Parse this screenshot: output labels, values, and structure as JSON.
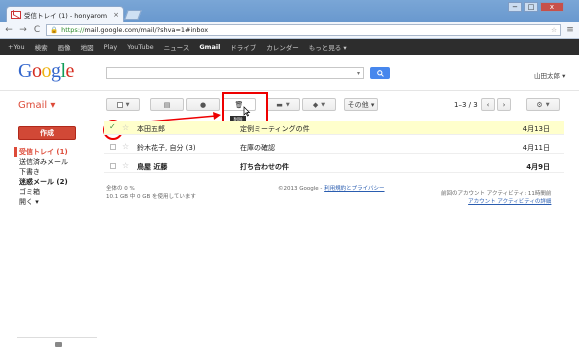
{
  "browser": {
    "tab_title": "受信トレイ (1) - honyarom",
    "tab_close": "×",
    "url_scheme": "https://",
    "url_rest": "mail.google.com/mail/?shva=1#inbox",
    "back_icon": "←",
    "forward_icon": "→",
    "reload_icon": "C",
    "star_icon": "☆",
    "menu_icon": "≡",
    "win_min": "−",
    "win_max": "□",
    "win_close": "x"
  },
  "gbar": {
    "items": [
      "+You",
      "検索",
      "画像",
      "地図",
      "Play",
      "YouTube",
      "ニュース",
      "Gmail",
      "ドライブ",
      "カレンダー",
      "もっと見る ▾"
    ]
  },
  "header": {
    "logo": [
      "G",
      "o",
      "o",
      "g",
      "l",
      "e"
    ],
    "search_placeholder": "",
    "user_name": "山田太郎 ▾"
  },
  "sidebar": {
    "gmail_label": "Gmail ▾",
    "compose": "作成",
    "items": [
      "受信トレイ (1)",
      "送信済みメール",
      "下書き",
      "迷惑メール (2)",
      "ゴミ箱",
      "開く ▾"
    ]
  },
  "toolbar": {
    "more_label": "その他 ▾",
    "pager": "1–3 / 3",
    "prev": "‹",
    "next": "›",
    "tooltip": "削除"
  },
  "messages": [
    {
      "sender": "本田五郎",
      "subject": "定例ミーティングの件",
      "date": "4月13日",
      "selected": true,
      "unread": false
    },
    {
      "sender": "鈴木花子, 自分 (3)",
      "subject": "在庫の確認",
      "date": "4月11日",
      "selected": false,
      "unread": false
    },
    {
      "sender": "鳥屋 近藤",
      "subject": "打ち合わせの件",
      "date": "4月9日",
      "selected": false,
      "unread": true
    }
  ],
  "footer": {
    "usage_line1": "全体の 0 %",
    "usage_line2": "10.1 GB 中 0 GB を使用しています",
    "copyright": "©2013 Google - ",
    "terms_link": "利用規約とプライバシー",
    "activity_line1": "前回のアカウント アクティビティ: 11時間前",
    "activity_link": "アカウント アクティビティの詳細"
  },
  "colors": {
    "accent_red": "#dd4b39",
    "compose_red": "#d14836",
    "search_blue": "#4787ed",
    "annotation_red": "#ee0000"
  }
}
